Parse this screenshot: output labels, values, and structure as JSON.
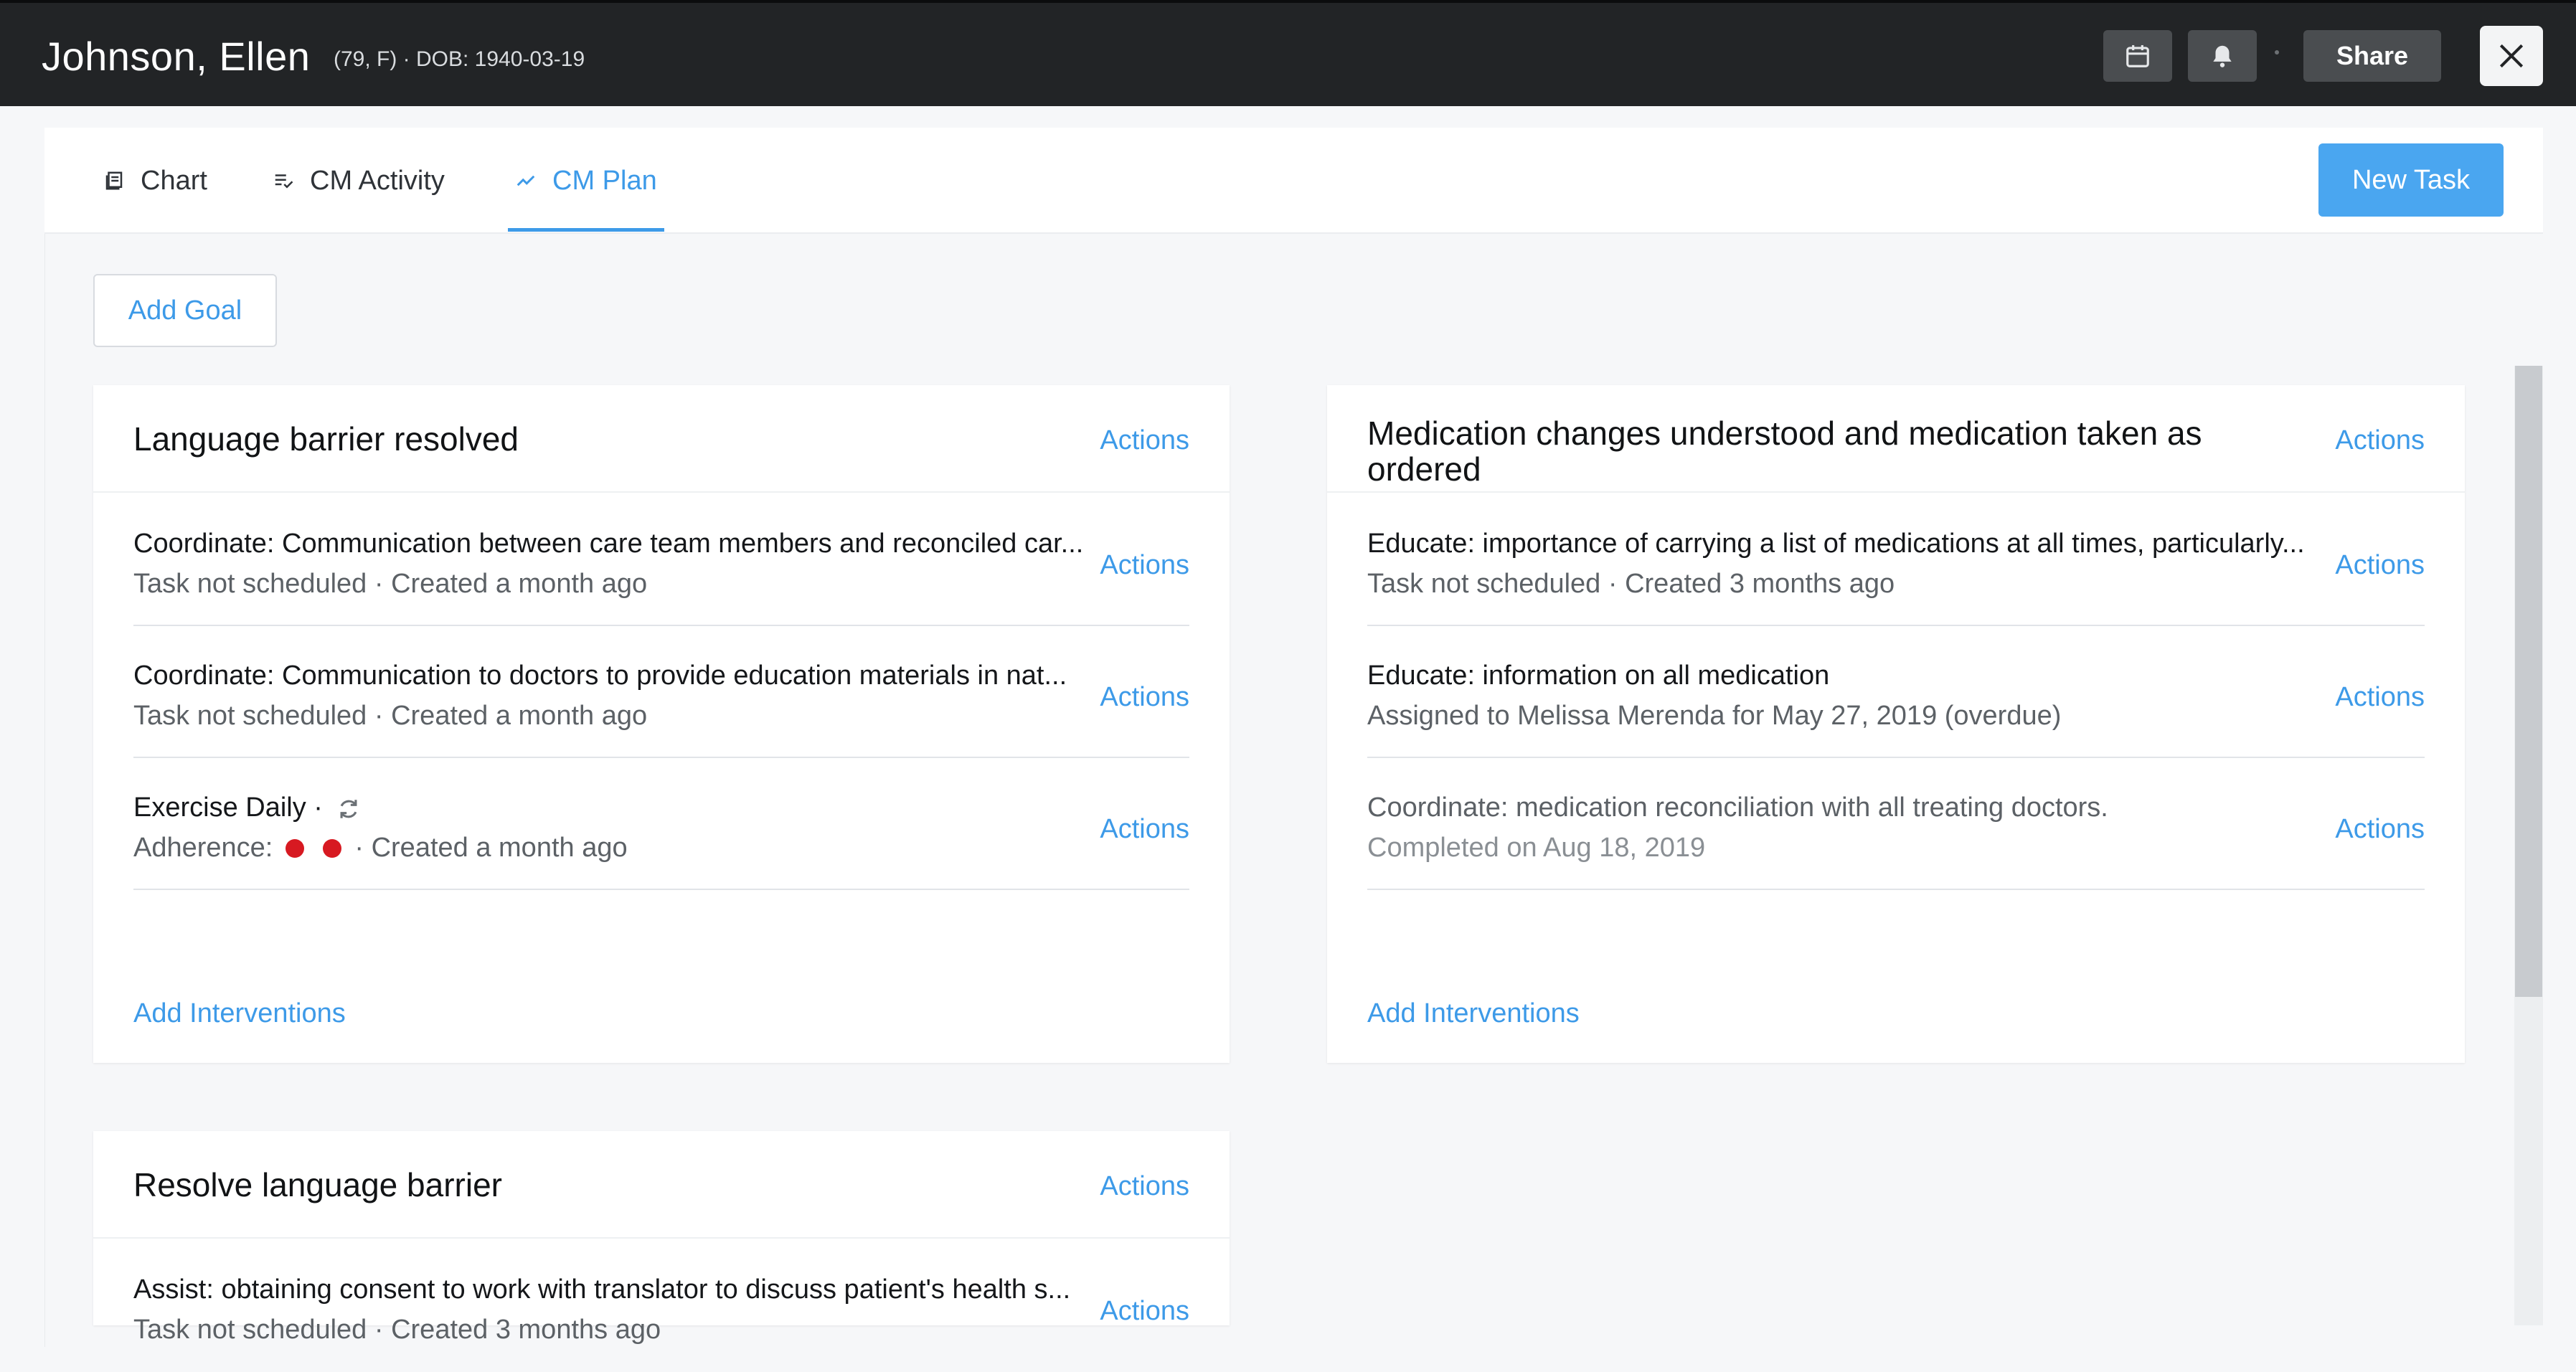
{
  "header": {
    "patient_name": "Johnson, Ellen",
    "patient_meta": "(79, F) · DOB: 1940-03-19",
    "share_label": "Share",
    "icons": [
      "calendar-icon",
      "bell-icon",
      "close-icon"
    ]
  },
  "tabs": [
    {
      "label": "Chart",
      "icon": "book-icon"
    },
    {
      "label": "CM Activity",
      "icon": "list-check-icon"
    },
    {
      "label": "CM Plan",
      "icon": "trend-icon",
      "active": true
    }
  ],
  "toolbar": {
    "new_task_label": "New Task",
    "add_goal_label": "Add Goal"
  },
  "colors": {
    "accent": "#3d9ae8",
    "topbar": "#222426",
    "overdue_dot": "#d71921"
  },
  "goals": [
    {
      "title": "Language barrier resolved",
      "actions_label": "Actions",
      "add_interventions_label": "Add Interventions",
      "tasks": [
        {
          "title": "Coordinate: Communication between care team members and reconciled car...",
          "subtitle": "Task not scheduled · Created a month ago",
          "actions_label": "Actions"
        },
        {
          "title": "Coordinate: Communication to doctors to provide education materials in nat...",
          "subtitle": "Task not scheduled · Created a month ago",
          "actions_label": "Actions"
        },
        {
          "title": "Exercise Daily ·",
          "adherence_label": "Adherence:",
          "adherence_suffix": "· Created a month ago",
          "actions_label": "Actions"
        }
      ]
    },
    {
      "title": "Medication changes understood and medication taken as ordered",
      "actions_label": "Actions",
      "add_interventions_label": "Add Interventions",
      "tasks": [
        {
          "title": "Educate: importance of carrying a list of medications at all times, particularly...",
          "subtitle": "Task not scheduled · Created 3 months ago",
          "actions_label": "Actions"
        },
        {
          "title": "Educate: information on all medication",
          "subtitle": "Assigned to Melissa Merenda for May 27, 2019 (overdue)",
          "actions_label": "Actions"
        },
        {
          "title": "Coordinate: medication reconciliation with all treating doctors.",
          "subtitle": "Completed on Aug 18, 2019",
          "actions_label": "Actions"
        }
      ]
    },
    {
      "title": "Resolve language barrier",
      "actions_label": "Actions",
      "tasks": [
        {
          "title": "Assist: obtaining consent to work with translator to discuss patient's health s...",
          "subtitle": "Task not scheduled · Created 3 months ago",
          "actions_label": "Actions"
        }
      ]
    }
  ]
}
